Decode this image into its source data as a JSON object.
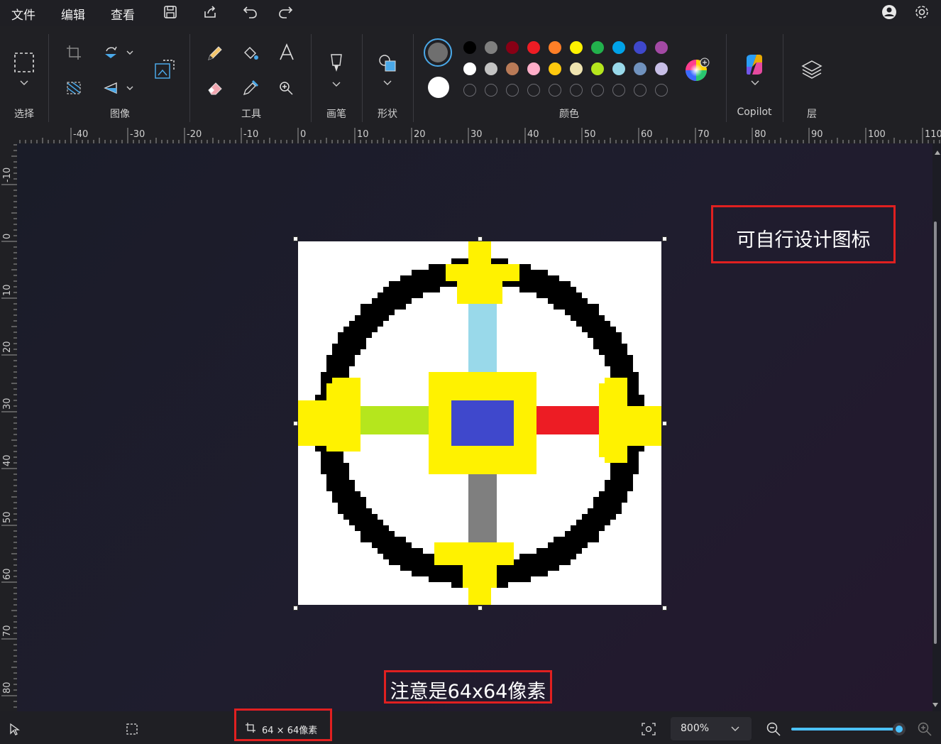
{
  "menu": {
    "file": "文件",
    "edit": "编辑",
    "view": "查看"
  },
  "toolbar": {
    "selection_label": "选择",
    "image_label": "图像",
    "tools_label": "工具",
    "brush_label": "画笔",
    "shapes_label": "形状",
    "colors_label": "颜色",
    "copilot_label": "Copilot",
    "layers_label": "层"
  },
  "palette": {
    "primary": "#6f6f6f",
    "secondary": "#ffffff",
    "row1": [
      "#000000",
      "#7f7f7f",
      "#880015",
      "#ed1c24",
      "#ff7f27",
      "#fff200",
      "#22b14c",
      "#00a2e8",
      "#3f48cc",
      "#a349a4"
    ],
    "row2": [
      "#ffffff",
      "#c3c3c3",
      "#b97a57",
      "#ffaec9",
      "#ffc90e",
      "#efe4b0",
      "#b5e61d",
      "#99d9ea",
      "#7092be",
      "#c8bfe7"
    ],
    "row3_empty_count": 10
  },
  "ruler": {
    "h_ticks": [
      "-40",
      "-30",
      "-20",
      "-10",
      "0",
      "10",
      "20",
      "30",
      "40",
      "50",
      "60",
      "70",
      "80",
      "90",
      "100",
      "110"
    ],
    "v_ticks": [
      "-10",
      "0",
      "10",
      "20",
      "30",
      "40",
      "50",
      "60",
      "70",
      "80"
    ]
  },
  "annotations": {
    "design_note": "可自行设计图标",
    "size_note": "注意是64x64像素"
  },
  "status": {
    "canvas_size": "64 × 64像素",
    "zoom": "800%",
    "zoom_slider_fraction": 1.0
  },
  "icon_pixels": {
    "grid": 64,
    "white_bg": "#ffffff",
    "ring": "#000000",
    "arms_yellow": "#fff200",
    "top_bar": "#99d9ea",
    "left_bar": "#b5e61d",
    "right_bar": "#ed1c24",
    "bottom_bar": "#7f7f7f",
    "center": "#3f48cc"
  }
}
